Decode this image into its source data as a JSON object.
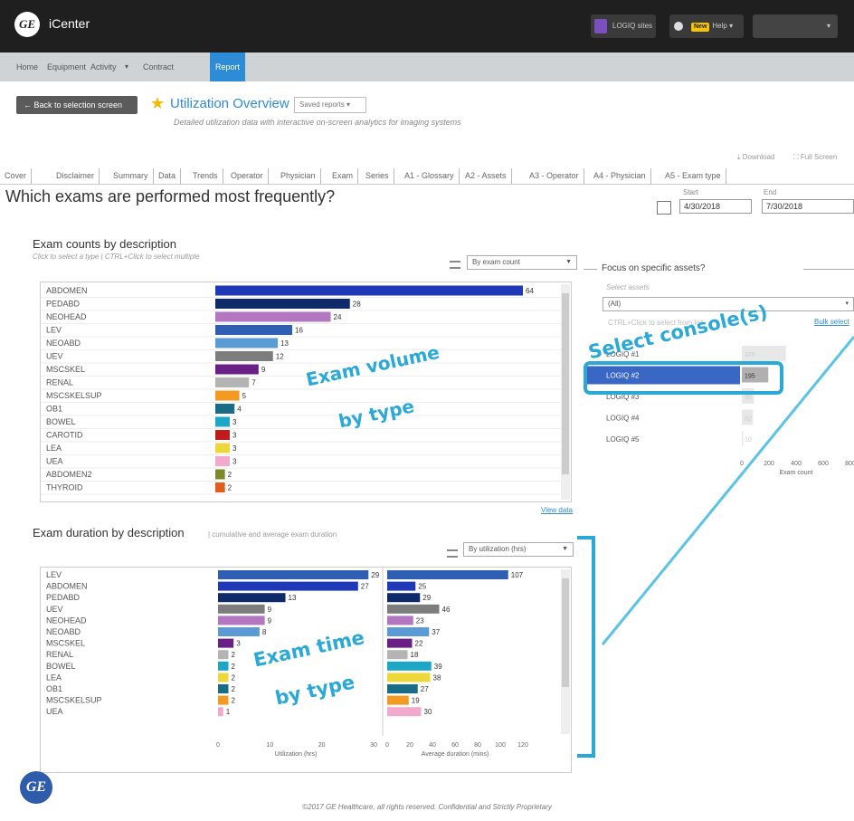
{
  "app": {
    "name": "iCenter",
    "logo_text": "GE"
  },
  "topbar": {
    "logiq_label": "LOGIQ sites",
    "new_badge": "New",
    "help_label": "Help"
  },
  "nav": {
    "items": [
      "Home",
      "Equipment",
      "Activity",
      "Contract",
      "Report"
    ],
    "active": "Report"
  },
  "header": {
    "back_label": "Back to selection screen",
    "title": "Utilization Overview",
    "saved_reports": "Saved reports",
    "subtitle": "Detailed utilization data with interactive on-screen analytics for imaging systems",
    "download": "Download",
    "fullscreen": "Full Screen"
  },
  "tabs": [
    "Cover",
    "Disclaimer",
    "Summary",
    "Data",
    "Trends",
    "Operator",
    "Physician",
    "Exam",
    "Series",
    "A1 - Glossary",
    "A2 - Assets",
    "A3 - Operator",
    "A4 - Physician",
    "A5 - Exam type"
  ],
  "question": "Which exams are performed most frequently?",
  "dates": {
    "start_label": "Start",
    "start_value": "4/30/2018",
    "end_label": "End",
    "end_value": "7/30/2018"
  },
  "counts_panel": {
    "title": "Exam counts by description",
    "subtitle": "Click to select a type | CTRL+Click to select multiple",
    "sort_option": "By exam count",
    "view_data": "View data"
  },
  "duration_panel": {
    "title": "Exam duration by description",
    "subtitle": "| cumulative and average exam duration",
    "sort_option": "By utilization (hrs)"
  },
  "focus_panel": {
    "title": "Focus on specific assets?",
    "select_label": "Select assets",
    "select_value": "(All)",
    "hint": "CTRL+Click to select from list",
    "bulk_select": "Bulk select"
  },
  "callouts": {
    "volume": [
      "Exam volume",
      "by type"
    ],
    "console": "Select console(s)",
    "time": [
      "Exam time",
      "by type"
    ]
  },
  "footer": "©2017 GE Healthcare, all rights reserved. Confidential and Strictly Proprietary",
  "colors": {
    "accent": "#2e8bd6",
    "callout": "#2aa9d9",
    "highlight": "#3a66c4"
  },
  "chart_data": [
    {
      "type": "bar",
      "title": "Exam counts by description",
      "categories": [
        "ABDOMEN",
        "PEDABD",
        "NEOHEAD",
        "LEV",
        "NEOABD",
        "UEV",
        "MSCSKEL",
        "RENAL",
        "MSCSKELSUP",
        "OB1",
        "BOWEL",
        "CAROTID",
        "LEA",
        "UEA",
        "ABDOMEN2",
        "THYROID"
      ],
      "values": [
        64,
        28,
        24,
        16,
        13,
        12,
        9,
        7,
        5,
        4,
        3,
        3,
        3,
        3,
        2,
        2
      ],
      "colors": [
        "#1f38b8",
        "#0e2a6b",
        "#b277c0",
        "#2f5fb3",
        "#5a9bd5",
        "#7d7d7d",
        "#6a1f86",
        "#b4b4b4",
        "#f39a23",
        "#1a6b86",
        "#1ea6c6",
        "#c01b1b",
        "#ecd83a",
        "#f2a9cc",
        "#7b8a2a",
        "#e25c1e"
      ]
    },
    {
      "type": "bar",
      "title": "Utilization (hrs)",
      "xlabel": "Utilization (hrs)",
      "xticks": [
        0,
        10,
        20,
        30
      ],
      "categories": [
        "LEV",
        "ABDOMEN",
        "PEDABD",
        "UEV",
        "NEOHEAD",
        "NEOABD",
        "MSCSKEL",
        "RENAL",
        "BOWEL",
        "LEA",
        "OB1",
        "MSCSKELSUP",
        "UEA"
      ],
      "values": [
        29,
        27,
        13,
        9,
        9,
        8,
        3,
        2,
        2,
        2,
        2,
        2,
        1
      ],
      "colors": [
        "#2f5fb3",
        "#1f38b8",
        "#0e2a6b",
        "#7d7d7d",
        "#b277c0",
        "#5a9bd5",
        "#6a1f86",
        "#b4b4b4",
        "#1ea6c6",
        "#ecd83a",
        "#1a6b86",
        "#f39a23",
        "#f2a9cc"
      ]
    },
    {
      "type": "bar",
      "title": "Average duration (mins)",
      "xlabel": "Average duration (mins)",
      "xticks": [
        0,
        20,
        40,
        60,
        80,
        100,
        120
      ],
      "categories": [
        "LEV",
        "ABDOMEN",
        "PEDABD",
        "UEV",
        "NEOHEAD",
        "NEOABD",
        "MSCSKEL",
        "RENAL",
        "BOWEL",
        "LEA",
        "OB1",
        "MSCSKELSUP",
        "UEA"
      ],
      "values": [
        107,
        25,
        29,
        46,
        23,
        37,
        22,
        18,
        39,
        38,
        27,
        19,
        30
      ],
      "colors": [
        "#2f5fb3",
        "#1f38b8",
        "#0e2a6b",
        "#7d7d7d",
        "#b277c0",
        "#5a9bd5",
        "#6a1f86",
        "#b4b4b4",
        "#1ea6c6",
        "#ecd83a",
        "#1a6b86",
        "#f39a23",
        "#f2a9cc"
      ]
    },
    {
      "type": "bar",
      "title": "Focus on specific assets?",
      "xlabel": "Exam count",
      "xticks": [
        0,
        200,
        400,
        600,
        800
      ],
      "categories": [
        "LOGIQ #1",
        "LOGIQ #2",
        "LOGIQ #3",
        "LOGIQ #4",
        "LOGIQ #5"
      ],
      "values": [
        325,
        195,
        90,
        82,
        10
      ],
      "selected": "LOGIQ #2"
    }
  ]
}
